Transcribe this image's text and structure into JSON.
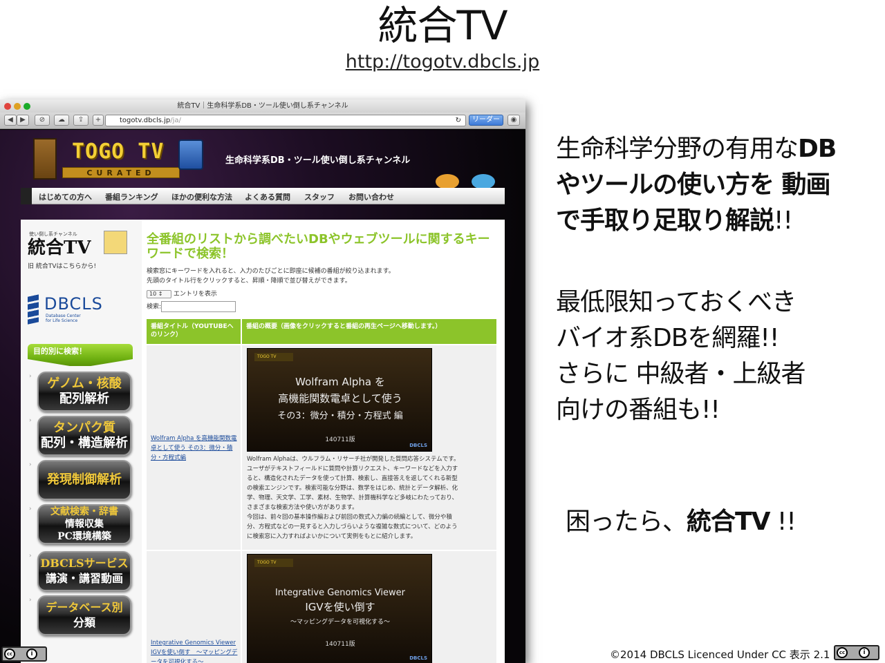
{
  "slide": {
    "title": "統合TV",
    "url": "http://togotv.dbcls.jp"
  },
  "browser": {
    "window_title": "統合TV｜生命科学系DB・ツール使い倒し系チャンネル",
    "address_host": "togotv.dbcls.jp",
    "address_path": "/ja/",
    "reader_label": "リーダー"
  },
  "site": {
    "logo_text": "TOGO TV",
    "logo_sub": "CURATED",
    "tagline": "生命科学系DB・ツール使い倒し系チャンネル",
    "nav": [
      "はじめての方へ",
      "番組ランキング",
      "ほかの便利な方法",
      "よくある質問",
      "スタッフ",
      "お問い合わせ"
    ]
  },
  "side": {
    "logo_caption": "使い倒し系チャンネル",
    "logo": "統合TV",
    "old_link": "旧 統合TVはこちらから!",
    "dbcls": "DBCLS",
    "dbcls_sub1": "Database Center",
    "dbcls_sub2": "for Life Science",
    "purpose": "目的別に検索！",
    "cats": [
      {
        "l1": "ゲノム・核酸",
        "l2": "配列解析"
      },
      {
        "l1": "タンパク質",
        "l2": "配列・構造解析"
      },
      {
        "l1": "発現制御解析"
      },
      {
        "l1": "文献検索・辞書",
        "l2": "情報収集",
        "l3": "PC環境構築"
      },
      {
        "l1": "DBCLSサービス",
        "l2": "講演・講習動画"
      },
      {
        "l1": "データベース別",
        "l2": "分類"
      }
    ]
  },
  "main": {
    "heading": "全番組のリストから調べたいDBやウェブツールに関するキーワードで検索！",
    "desc1": "検索窓にキーワードを入れると、入力のたびごとに即座に候補の番組が絞り込まれます。",
    "desc2": "先頭のタイトル行をクリックすると、昇順・降順で並び替えができます。",
    "entries_value": "10 ↕",
    "entries_label": "エントリを表示",
    "search_label": "検索:",
    "columns": [
      "番組タイトル（YOUTUBEへのリンク）",
      "番組の概要（画像をクリックすると番組の再生ページへ移動します。）"
    ],
    "rows": [
      {
        "link": "Wolfram Alpha を高機能関数電卓として使う その3：微分・積分・方程式編",
        "thumb_logo": "TOGO TV",
        "thumb_l1": "Wolfram Alpha を",
        "thumb_l2": "高機能関数電卓として使う",
        "thumb_l3": "その3：微分・積分・方程式 編",
        "thumb_ver": "140711版",
        "thumb_badge": "DBCLS",
        "text": [
          "Wolfram Alphaは、ウルフラム・リサーチ社が開発した質問応答システムです。",
          "ユーザがテキストフィールドに質問や計算リクエスト、キーワードなどを入力す",
          "ると、構造化されたデータを使って計算、検索し、直接答えを返してくれる新型",
          "の検索エンジンです。検索可能な分野は、数学をはじめ、統計とデータ解析、化",
          "学、物理、天文学、工学、素材、生物学、計算機科学など多岐にわたっており、",
          "さまざまな検索方法や使い方があります。",
          "今回は、前々回の基本操作編および前回の数式入力編の続編として、微分や積",
          "分、方程式などの一見すると入力しづらいような複雑な数式について、どのよう",
          "に検索窓に入力すればよいかについて実例をもとに紹介します。",
          ""
        ]
      },
      {
        "link": "Integrative Genomics Viewer IGVを使い倒す　～マッピングデータを可視化する～",
        "thumb_logo": "TOGO TV",
        "thumb_l1": "Integrative Genomics Viewer",
        "thumb_l2": "IGVを使い倒す",
        "thumb_l3": "～マッピングデータを可視化する～",
        "thumb_ver": "140711版",
        "thumb_badge": "DBCLS"
      }
    ]
  },
  "right": {
    "b1": {
      "l1a": "生命科学分野の有用な",
      "l1b": "DB",
      "l2": "やツールの使い方を 動画",
      "l3a": "で手取り足取り解説",
      "l3b": "!!"
    },
    "b2": [
      "最低限知っておくべき",
      "バイオ系DBを網羅!!",
      "さらに 中級者・上級者",
      "向けの番組も!!"
    ],
    "b3a": "困ったら、",
    "b3b": "統合TV",
    "b3c": " !!"
  },
  "footer": {
    "copyright": "©2014 DBCLS Licenced Under CC 表示 2.1",
    "cc_mark": "cc",
    "by_mark": "i"
  }
}
